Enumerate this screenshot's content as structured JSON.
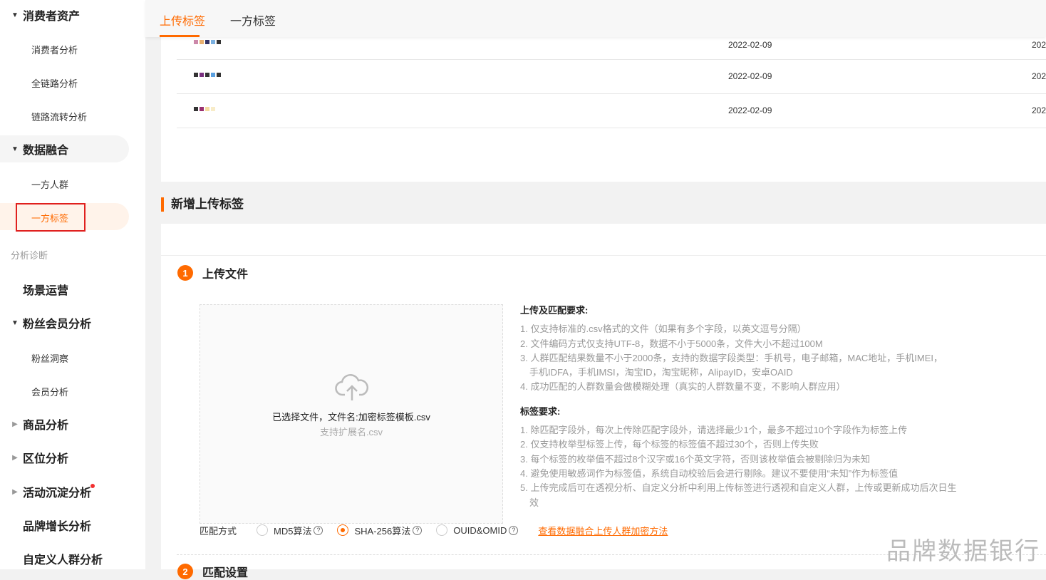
{
  "sidebar": {
    "consumer_assets": "消费者资产",
    "consumer_analysis": "消费者分析",
    "full_chain": "全链路分析",
    "chain_flow": "链路流转分析",
    "data_fusion": "数据融合",
    "first_party_crowd": "一方人群",
    "first_party_tags": "一方标签",
    "group_diagnosis": "分析诊断",
    "scene_ops": "场景运营",
    "fan_member": "粉丝会员分析",
    "fan_insight": "粉丝洞察",
    "member_analysis": "会员分析",
    "product_analysis": "商品分析",
    "zone_analysis": "区位分析",
    "activity_analysis": "活动沉淀分析",
    "brand_growth": "品牌增长分析",
    "custom_crowd": "自定义人群分析"
  },
  "tabs": {
    "upload": "上传标签",
    "first_party": "一方标签"
  },
  "table": {
    "rows": [
      {
        "date1": "2022-02-09",
        "date2": "202"
      },
      {
        "date1": "2022-02-09",
        "date2": "202"
      },
      {
        "date1": "2022-02-09",
        "date2": "202"
      }
    ]
  },
  "new_upload": {
    "title": "新增上传标签",
    "step1": {
      "num": "1",
      "title": "上传文件"
    },
    "dropzone": {
      "file": "已选择文件，文件名:加密标签模板.csv",
      "ext": "支持扩展名.csv"
    },
    "upload_req": {
      "title": "上传及匹配要求:",
      "items": [
        "1. 仅支持标准的.csv格式的文件（如果有多个字段，以英文逗号分隔）",
        "2. 文件编码方式仅支持UTF-8，数据不小于5000条，文件大小不超过100M",
        "3. 人群匹配结果数量不小于2000条，支持的数据字段类型：手机号，电子邮箱，MAC地址，手机IMEI，手机IDFA，手机IMSI，淘宝ID，淘宝昵称，AlipayID，安卓OAID",
        "4. 成功匹配的人群数量会做模糊处理（真实的人群数量不变，不影响人群应用）"
      ]
    },
    "tag_req": {
      "title": "标签要求:",
      "items": [
        "1. 除匹配字段外，每次上传除匹配字段外，请选择最少1个，最多不超过10个字段作为标签上传",
        "2. 仅支持枚举型标签上传，每个标签的标签值不超过30个，否则上传失败",
        "3. 每个标签的枚举值不超过8个汉字或16个英文字符，否则该枚举值会被剔除归为未知",
        "4. 避免使用敏感词作为标签值，系统自动校验后会进行剔除。建议不要使用“未知”作为标签值",
        "5. 上传完成后可在透视分析、自定义分析中利用上传标签进行透视和自定义人群，上传或更新成功后次日生效"
      ]
    },
    "match": {
      "label": "匹配方式",
      "options": [
        "MD5算法",
        "SHA-256算法",
        "OUID&OMID"
      ],
      "selected": "SHA-256算法",
      "link": "查看数据融合上传人群加密方法"
    },
    "step2": {
      "num": "2",
      "title": "匹配设置"
    }
  },
  "watermark": "品牌数据银行",
  "colors": {
    "accent": "#ff6a00"
  }
}
